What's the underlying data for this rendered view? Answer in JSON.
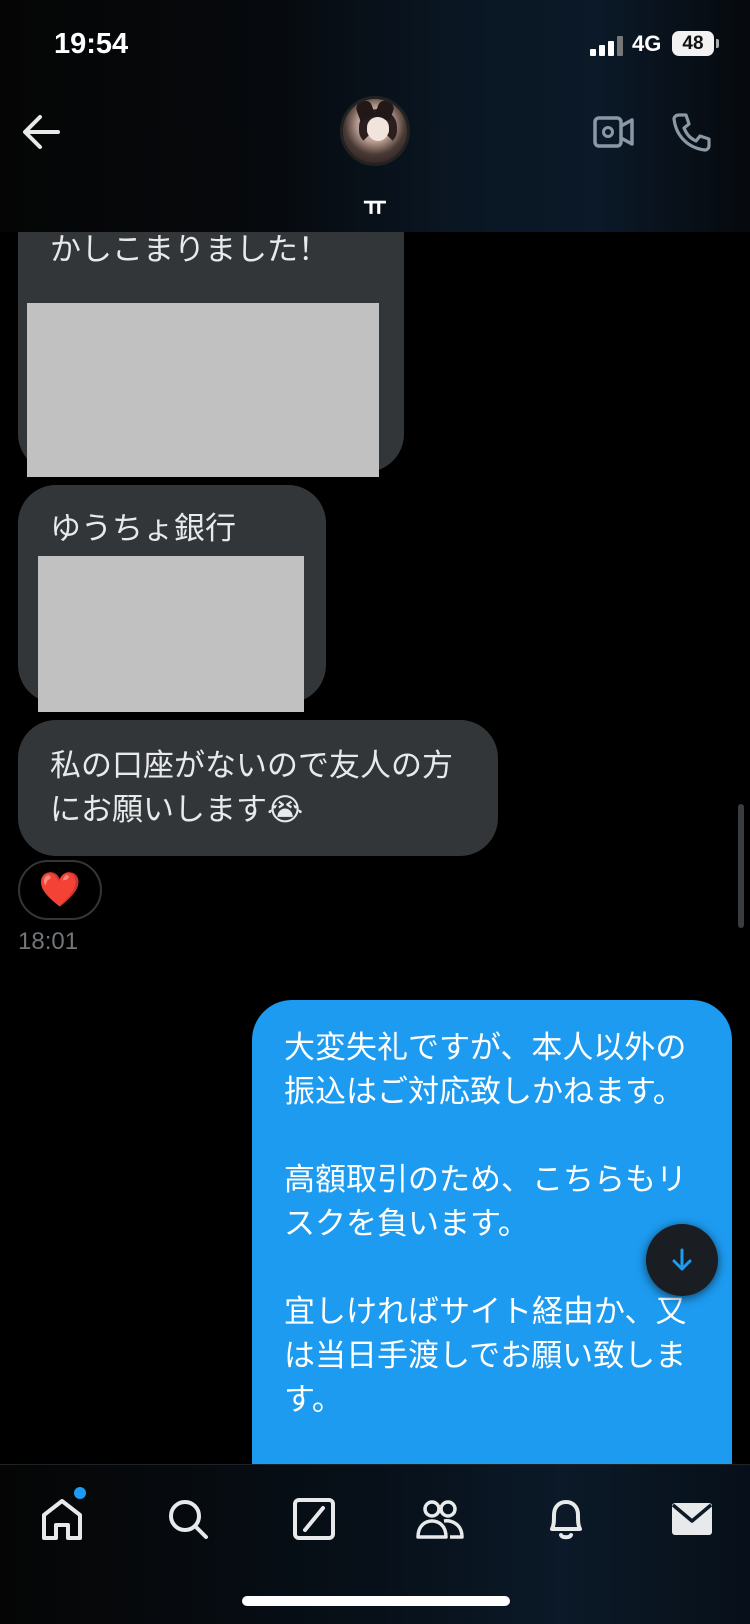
{
  "status_bar": {
    "time": "19:54",
    "network": "4G",
    "battery": "48"
  },
  "header": {
    "username": "ㅠ"
  },
  "messages": {
    "m1_text": "かしこまりました！",
    "m2_text": "ゆうちょ銀行",
    "m3_text": "私の口座がないので友人の方にお願いします😭",
    "reaction": "❤️",
    "timestamp": "18:01",
    "sent_text": "大変失礼ですが、本人以外の振込はご対応致しかねます。\n\n高額取引のため、こちらもリスクを負います。\n\n宜しければサイト経由か、又は当日手渡しでお願い致します。"
  },
  "colors": {
    "sent_bubble": "#1d9bf0",
    "received_bubble": "#333639",
    "accent": "#1d9bf0"
  },
  "icons": [
    "back-arrow-icon",
    "video-icon",
    "phone-icon",
    "arrow-down-icon",
    "home-icon",
    "search-icon",
    "grok-icon",
    "communities-icon",
    "bell-icon",
    "mail-icon"
  ]
}
